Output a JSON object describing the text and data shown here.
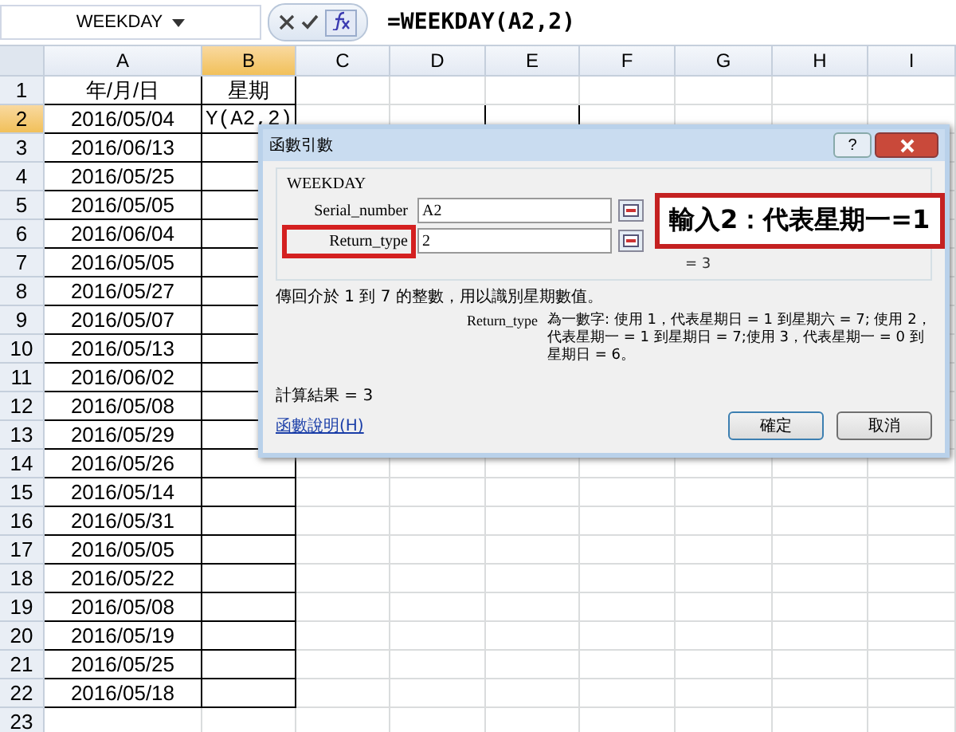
{
  "formula_bar": {
    "name_box": "WEEKDAY",
    "formula": "=WEEKDAY(A2,2)"
  },
  "columns": [
    {
      "label": "A",
      "selected": false
    },
    {
      "label": "B",
      "selected": true
    },
    {
      "label": "C",
      "selected": false
    },
    {
      "label": "D",
      "selected": false
    },
    {
      "label": "E",
      "selected": false
    },
    {
      "label": "F",
      "selected": false
    },
    {
      "label": "G",
      "selected": false
    },
    {
      "label": "H",
      "selected": false
    },
    {
      "label": "I",
      "selected": false
    }
  ],
  "rows": [
    {
      "number": "1",
      "selected": false,
      "cells": [
        "年/月/日",
        "星期",
        "",
        "",
        ""
      ]
    },
    {
      "number": "2",
      "selected": true,
      "cells": [
        "2016/05/04",
        "Y(A2,2)",
        "",
        "",
        ""
      ]
    },
    {
      "number": "3",
      "selected": false,
      "cells": [
        "2016/06/13",
        "",
        "",
        "",
        ""
      ]
    },
    {
      "number": "4",
      "selected": false,
      "cells": [
        "2016/05/25",
        "",
        "",
        "",
        ""
      ]
    },
    {
      "number": "5",
      "selected": false,
      "cells": [
        "2016/05/05",
        "",
        "",
        "",
        ""
      ]
    },
    {
      "number": "6",
      "selected": false,
      "cells": [
        "2016/06/04",
        "",
        "",
        "",
        ""
      ]
    },
    {
      "number": "7",
      "selected": false,
      "cells": [
        "2016/05/05",
        "",
        "",
        "",
        ""
      ]
    },
    {
      "number": "8",
      "selected": false,
      "cells": [
        "2016/05/27",
        "",
        "",
        "",
        ""
      ]
    },
    {
      "number": "9",
      "selected": false,
      "cells": [
        "2016/05/07",
        "",
        "",
        "",
        ""
      ]
    },
    {
      "number": "10",
      "selected": false,
      "cells": [
        "2016/05/13",
        "",
        "",
        "",
        ""
      ]
    },
    {
      "number": "11",
      "selected": false,
      "cells": [
        "2016/06/02",
        "",
        "",
        "",
        ""
      ]
    },
    {
      "number": "12",
      "selected": false,
      "cells": [
        "2016/05/08",
        "",
        "",
        "",
        ""
      ]
    },
    {
      "number": "13",
      "selected": false,
      "cells": [
        "2016/05/29",
        "",
        "",
        "",
        ""
      ]
    },
    {
      "number": "14",
      "selected": false,
      "cells": [
        "2016/05/26",
        "",
        "",
        "",
        ""
      ]
    },
    {
      "number": "15",
      "selected": false,
      "cells": [
        "2016/05/14",
        "",
        "",
        "",
        ""
      ]
    },
    {
      "number": "16",
      "selected": false,
      "cells": [
        "2016/05/31",
        "",
        "",
        "",
        ""
      ]
    },
    {
      "number": "17",
      "selected": false,
      "cells": [
        "2016/05/05",
        "",
        "",
        "",
        ""
      ]
    },
    {
      "number": "18",
      "selected": false,
      "cells": [
        "2016/05/22",
        "",
        "",
        "",
        ""
      ]
    },
    {
      "number": "19",
      "selected": false,
      "cells": [
        "2016/05/08",
        "",
        "",
        "",
        ""
      ]
    },
    {
      "number": "20",
      "selected": false,
      "cells": [
        "2016/05/19",
        "",
        "",
        "",
        ""
      ]
    },
    {
      "number": "21",
      "selected": false,
      "cells": [
        "2016/05/25",
        "",
        "",
        "",
        ""
      ]
    },
    {
      "number": "22",
      "selected": false,
      "cells": [
        "2016/05/18",
        "",
        "",
        "",
        ""
      ]
    },
    {
      "number": "23",
      "selected": false,
      "cells": [
        "",
        "",
        "",
        "",
        ""
      ]
    }
  ],
  "dialog": {
    "title": "函數引數",
    "help_button": "?",
    "function_name": "WEEKDAY",
    "arguments": [
      {
        "label": "Serial_number",
        "value": "A2",
        "highlighted": false
      },
      {
        "label": "Return_type",
        "value": "2",
        "highlighted": true
      }
    ],
    "formula_value": "= 3",
    "description": "傳回介於 1 到 7 的整數，用以識別星期數值。",
    "arg_help_label": "Return_type",
    "arg_help_text": "為一數字: 使用 1，代表星期日 = 1 到星期六 = 7; 使用 2，代表星期一 = 1 到星期日 = 7;使用 3，代表星期一 = 0 到星期日 = 6。",
    "result": "計算結果 =   3",
    "help_link": "函數說明(H)",
    "ok": "確定",
    "cancel": "取消"
  },
  "callout": "輸入2：代表星期一=1"
}
